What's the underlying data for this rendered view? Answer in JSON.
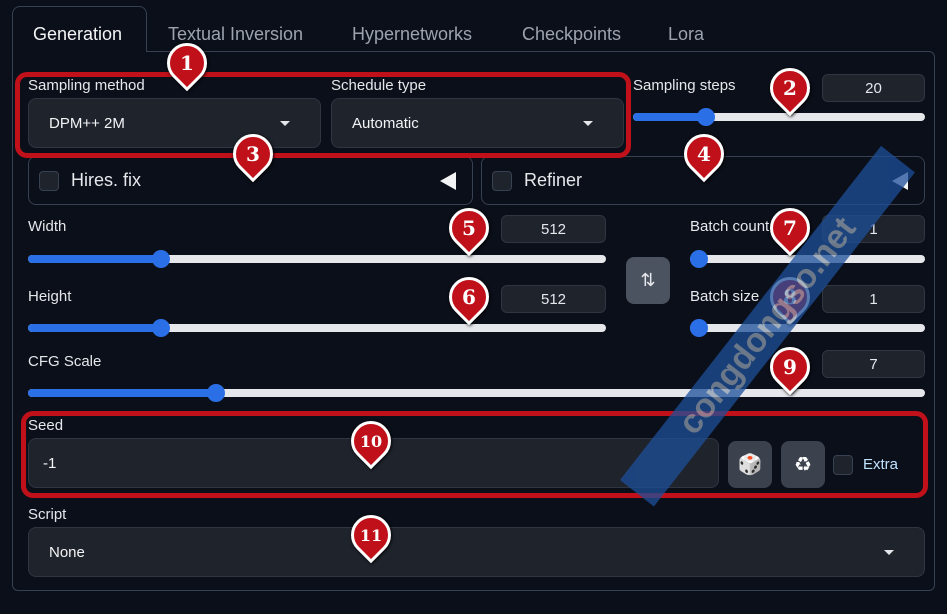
{
  "tabs": [
    "Generation",
    "Textual Inversion",
    "Hypernetworks",
    "Checkpoints",
    "Lora"
  ],
  "sampling": {
    "method_label": "Sampling method",
    "method_value": "DPM++ 2M",
    "schedule_label": "Schedule type",
    "schedule_value": "Automatic",
    "steps_label": "Sampling steps",
    "steps_value": "20",
    "steps_fraction": 0.25
  },
  "hires": {
    "label": "Hires. fix",
    "checked": false
  },
  "refiner": {
    "label": "Refiner",
    "checked": false
  },
  "width": {
    "label": "Width",
    "value": "512",
    "fraction": 0.23
  },
  "height": {
    "label": "Height",
    "value": "512",
    "fraction": 0.23
  },
  "swap_icon": "swap-vertical-icon",
  "batch_count": {
    "label": "Batch count",
    "value": "1",
    "fraction": 0
  },
  "batch_size": {
    "label": "Batch size",
    "value": "1",
    "fraction": 0
  },
  "cfg": {
    "label": "CFG Scale",
    "value": "7",
    "fraction": 0.21
  },
  "seed": {
    "label": "Seed",
    "value": "-1",
    "random_icon": "dice-icon",
    "reuse_icon": "recycle-icon",
    "extra_label": "Extra"
  },
  "script": {
    "label": "Script",
    "value": "None"
  },
  "annotations": [
    "1",
    "2",
    "3",
    "4",
    "5",
    "6",
    "7",
    "8",
    "9",
    "10",
    "11"
  ],
  "watermark": "congdongso.net",
  "colors": {
    "accent": "#2b6fe6",
    "annotation": "#c0111a",
    "background": "#0b0f19"
  }
}
